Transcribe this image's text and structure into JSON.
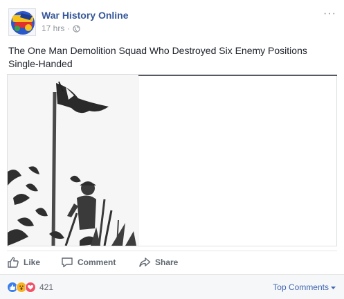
{
  "post": {
    "page_name": "War History Online",
    "time": "17 hrs",
    "separator": "·",
    "privacy_icon": "globe-icon",
    "more_icon": "ellipsis-icon",
    "more_label": "···",
    "caption": "The One Man Demolition Squad Who Destroyed Six Enemy Positions Single-Handed"
  },
  "actions": {
    "like": {
      "label": "Like",
      "icon": "thumbs-up-icon"
    },
    "comment": {
      "label": "Comment",
      "icon": "speech-bubble-icon"
    },
    "share": {
      "label": "Share",
      "icon": "share-arrow-icon"
    }
  },
  "footer": {
    "reaction_icons": [
      "like-reaction-icon",
      "wow-reaction-icon",
      "love-reaction-icon"
    ],
    "reaction_count": "421",
    "sort_label": "Top Comments",
    "sort_icon": "caret-down-icon"
  },
  "colors": {
    "link": "#365899",
    "meta": "#90949c",
    "action": "#606770",
    "like": "#3b7ee9",
    "wow": "#f7b125",
    "love": "#f25268",
    "sort": "#4267b2"
  }
}
